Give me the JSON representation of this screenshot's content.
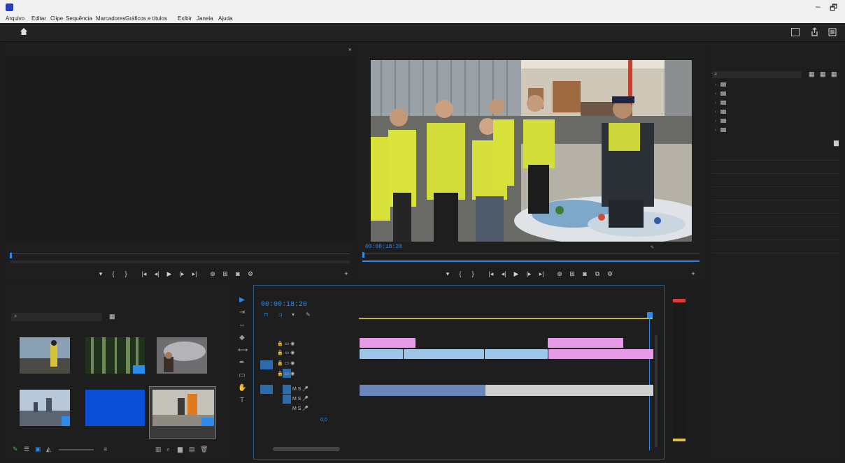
{
  "window": {
    "title": "",
    "controls": [
      "–",
      "🗗"
    ]
  },
  "menu": [
    "Arquivo",
    "Editar",
    "Clipe",
    "Sequência",
    "Marcadores",
    "Gráficos e títulos",
    "Exibir",
    "Janela",
    "Ajuda"
  ],
  "workspaces": {
    "tabs": [
      "",
      "",
      ""
    ],
    "active_index": 1,
    "project_title": ""
  },
  "source_monitor": {
    "tabs": [
      "",
      "",
      "",
      ""
    ],
    "timecode_in": "",
    "fit_label": "",
    "timecode_out": ""
  },
  "program_monitor": {
    "tabs": [
      "",
      ""
    ],
    "timecode": "00:00:18:20",
    "fit_label": "",
    "quality": "",
    "duration": ""
  },
  "project_panel": {
    "tabs": [
      "",
      "",
      ""
    ],
    "bin_path": "",
    "item_count": "",
    "items": [
      {
        "name": "",
        "duration": ""
      },
      {
        "name": "",
        "duration": ""
      },
      {
        "name": "",
        "duration": ""
      },
      {
        "name": "",
        "duration": ""
      },
      {
        "name": "",
        "duration": ""
      },
      {
        "name": "",
        "duration": ""
      }
    ]
  },
  "timeline": {
    "tab": "",
    "timecode": "00:00:18:20",
    "ruler": [
      "",
      ""
    ],
    "clips_v2": [
      {
        "label": "",
        "color": "#e89ae8"
      },
      {
        "label": "",
        "color": "#e89ae8"
      }
    ],
    "clips_v1": [
      {
        "label": "",
        "color": "#9ec6e8"
      },
      {
        "label": "",
        "color": "#9ec6e8"
      },
      {
        "label": "",
        "color": "#9ec6e8"
      },
      {
        "label": "",
        "color": "#e89ae8"
      }
    ],
    "clips_a1": [
      {
        "label": "",
        "color": "#6a86b8"
      },
      {
        "label": "",
        "color": "#cfcfcf"
      }
    ],
    "master_label": ""
  },
  "audio_meter": {
    "scale": [
      "",
      "",
      "",
      "",
      "",
      "",
      "",
      "",
      "",
      "",
      "",
      "",
      ""
    ]
  },
  "effects_panel": {
    "tab": "",
    "header": "",
    "search_placeholder": "",
    "folders": [
      "",
      "",
      "",
      "",
      "",
      "",
      ""
    ],
    "sections": [
      "",
      "",
      "",
      "",
      "",
      "",
      "",
      "",
      ""
    ]
  },
  "colors": {
    "accent": "#2d8ceb",
    "panel_bg": "#1e1e1e",
    "clip_video": "#9ec6e8",
    "clip_pink": "#e89ae8",
    "clip_audio": "#6a86b8"
  }
}
